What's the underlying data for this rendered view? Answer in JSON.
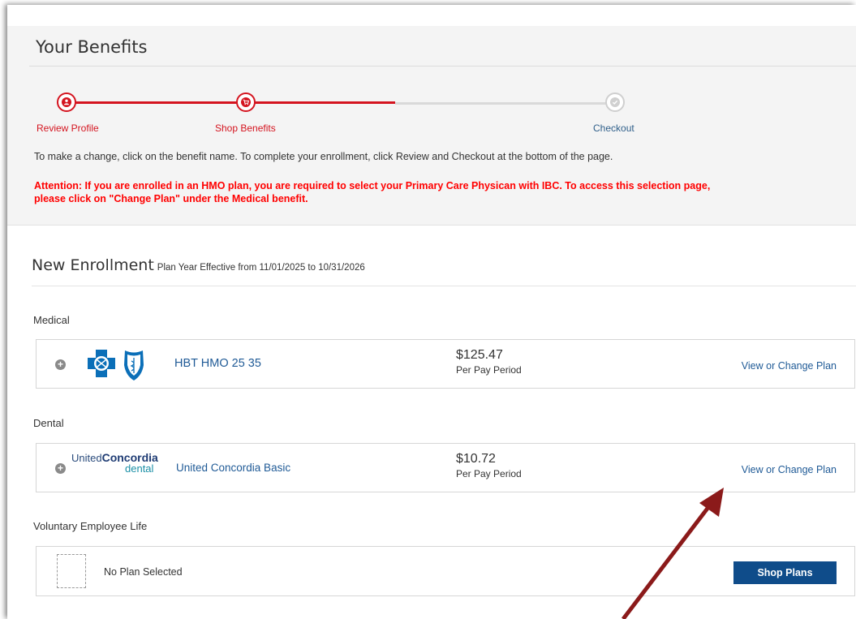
{
  "header": {
    "title": "Your Benefits"
  },
  "progress": {
    "steps": [
      {
        "label": "Review Profile",
        "state": "complete",
        "icon": "user-icon"
      },
      {
        "label": "Shop Benefits",
        "state": "current",
        "icon": "cart-icon"
      },
      {
        "label": "Checkout",
        "state": "pending",
        "icon": "check-icon"
      }
    ]
  },
  "instructions": "To make a change, click on the benefit name. To complete your enrollment, click Review and Checkout at the bottom of the page.",
  "attention": {
    "line1": "Attention: If you are enrolled in an HMO plan, you are required to select your Primary Care Physican with IBC.  To access this selection page,",
    "line2": "please click on \"Change Plan\" under the Medical benefit."
  },
  "enrollment": {
    "title": "New Enrollment",
    "subtitle": "Plan Year Effective from 11/01/2025 to 10/31/2026",
    "benefits": [
      {
        "category": "Medical",
        "plan_name": "HBT HMO 25 35",
        "price": "$125.47",
        "price_period": "Per Pay Period",
        "action": "View or Change Plan",
        "logo": "blue-cross-blue-shield-logo"
      },
      {
        "category": "Dental",
        "plan_name": "United Concordia Basic",
        "price": "$10.72",
        "price_period": "Per Pay Period",
        "action": "View or Change Plan",
        "logo_text": {
          "united": "United",
          "concordia": "Concordia",
          "dental": "dental"
        }
      },
      {
        "category": "Voluntary Employee Life",
        "plan_name": "No Plan Selected",
        "action": "Shop Plans"
      }
    ]
  },
  "colors": {
    "accent_red": "#d4141f",
    "link_blue": "#1f5a96",
    "button_blue": "#0f4c8a",
    "attention_red": "#ff0000",
    "annotation_arrow": "#8b1a1a"
  }
}
